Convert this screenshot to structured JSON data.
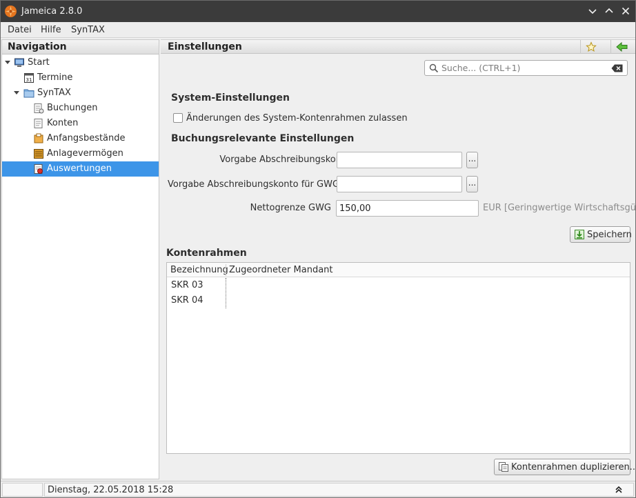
{
  "window": {
    "title": "Jameica 2.8.0"
  },
  "menu": {
    "items": [
      "Datei",
      "Hilfe",
      "SynTAX"
    ]
  },
  "navigation": {
    "header": "Navigation",
    "items": [
      {
        "label": "Start",
        "icon": "computer-icon"
      },
      {
        "label": "Termine",
        "icon": "calendar-icon"
      },
      {
        "label": "SynTAX",
        "icon": "folder-icon"
      },
      {
        "label": "Buchungen",
        "icon": "bookings-icon"
      },
      {
        "label": "Konten",
        "icon": "accounts-icon"
      },
      {
        "label": "Anfangsbestände",
        "icon": "opening-balance-icon"
      },
      {
        "label": "Anlagevermögen",
        "icon": "fixed-assets-icon"
      },
      {
        "label": "Auswertungen",
        "icon": "reports-icon",
        "selected": true
      }
    ]
  },
  "main": {
    "title": "Einstellungen",
    "search_placeholder": "Suche...   (CTRL+1)",
    "system_section": "System-Einstellungen",
    "checkbox_label": "Änderungen des System-Kontenrahmen zulassen",
    "checkbox_checked": false,
    "booking_section": "Buchungsrelevante Einstellungen",
    "fields": {
      "abschreibung_label": "Vorgabe Abschreibungskonto",
      "abschreibung_value": "",
      "gwg_konto_label": "Vorgabe Abschreibungskonto für GWG",
      "gwg_konto_value": "",
      "nettogrenze_label": "Nettogrenze GWG",
      "nettogrenze_value": "150,00",
      "nettogrenze_hint": "EUR [Geringwertige Wirtschaftsgüt",
      "browse_label": "..."
    },
    "save_label": "Speichern",
    "kontenrahmen_section": "Kontenrahmen",
    "table": {
      "columns": [
        "Bezeichnung",
        "Zugeordneter Mandant"
      ],
      "rows": [
        [
          "SKR 03",
          ""
        ],
        [
          "SKR 04",
          ""
        ]
      ]
    },
    "duplicate_label": "Kontenrahmen duplizieren..."
  },
  "status": {
    "datetime": "Dienstag, 22.05.2018 15:28"
  },
  "colors": {
    "selection": "#3d95e8",
    "titlebar": "#3b3b3b",
    "accent_green": "#3aa335"
  }
}
